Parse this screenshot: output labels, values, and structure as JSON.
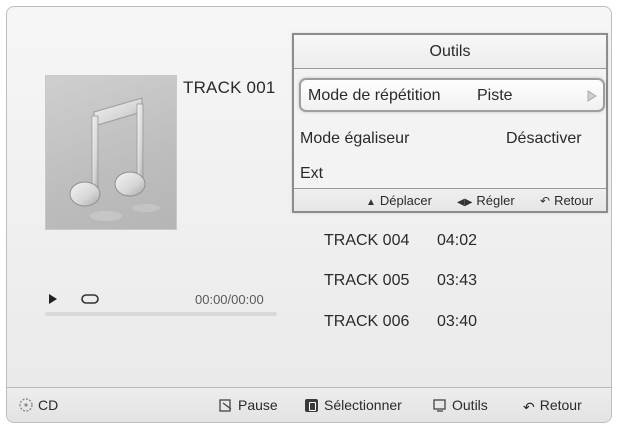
{
  "player": {
    "current_track": "TRACK 001",
    "time": "00:00/00:00",
    "progress": 0,
    "icons": {
      "play_status": "play-icon",
      "repeat": "repeat-icon",
      "album_art": "music-note-icon"
    }
  },
  "track_list": [
    {
      "name": "TRACK 004",
      "duration": "04:02"
    },
    {
      "name": "TRACK 005",
      "duration": "03:43"
    },
    {
      "name": "TRACK 006",
      "duration": "03:40"
    }
  ],
  "tools_popup": {
    "title": "Outils",
    "items": [
      {
        "label": "Mode de répétition",
        "value": "Piste",
        "selected": true
      },
      {
        "label": "Mode égaliseur",
        "value": "Désactiver"
      },
      {
        "label": "Ext"
      }
    ],
    "hints": {
      "move": "Déplacer",
      "adjust": "Régler",
      "back": "Retour"
    }
  },
  "bottom_bar": {
    "source": "CD",
    "pause": "Pause",
    "select": "Sélectionner",
    "tools": "Outils",
    "back": "Retour"
  },
  "colors": {
    "background": "#efefef",
    "text": "#2b2b2b",
    "border": "#8c8c8c"
  }
}
